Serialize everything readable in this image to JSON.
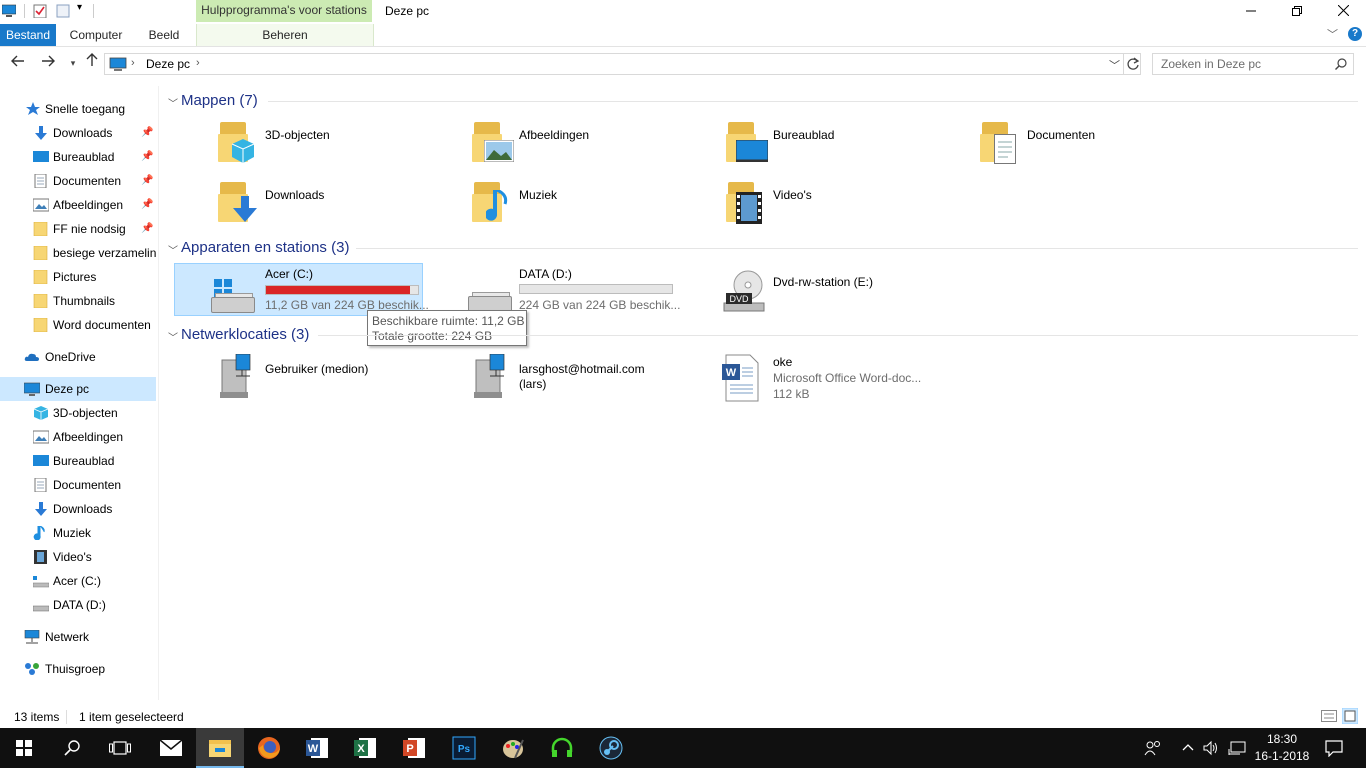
{
  "window": {
    "title": "Deze pc",
    "context_tab_header": "Hulpprogramma's voor stations",
    "controls": [
      "minimize",
      "maximize",
      "close"
    ]
  },
  "ribbon": {
    "tabs": [
      {
        "label": "Bestand",
        "active": true
      },
      {
        "label": "Computer"
      },
      {
        "label": "Beeld"
      },
      {
        "label": "Beheren"
      }
    ]
  },
  "address": {
    "breadcrumb": [
      "Deze pc"
    ],
    "search_placeholder": "Zoeken in Deze pc"
  },
  "nav_pane": {
    "quick_access": "Snelle toegang",
    "quick_items": [
      {
        "label": "Downloads",
        "icon": "download-arrow-icon",
        "pinned": true
      },
      {
        "label": "Bureaublad",
        "icon": "desktop-icon",
        "pinned": true
      },
      {
        "label": "Documenten",
        "icon": "document-icon",
        "pinned": true
      },
      {
        "label": "Afbeeldingen",
        "icon": "pictures-icon",
        "pinned": true
      },
      {
        "label": "FF nie nodsig",
        "icon": "folder-icon",
        "pinned": true
      },
      {
        "label": "besiege verzameling",
        "icon": "folder-icon"
      },
      {
        "label": "Pictures",
        "icon": "folder-icon"
      },
      {
        "label": "Thumbnails",
        "icon": "folder-icon"
      },
      {
        "label": "Word documenten",
        "icon": "folder-icon"
      }
    ],
    "onedrive": "OneDrive",
    "this_pc": "Deze pc",
    "this_pc_items": [
      {
        "label": "3D-objecten",
        "icon": "cube-icon"
      },
      {
        "label": "Afbeeldingen",
        "icon": "pictures-icon"
      },
      {
        "label": "Bureaublad",
        "icon": "desktop-icon"
      },
      {
        "label": "Documenten",
        "icon": "document-icon"
      },
      {
        "label": "Downloads",
        "icon": "download-arrow-icon"
      },
      {
        "label": "Muziek",
        "icon": "music-note-icon"
      },
      {
        "label": "Video's",
        "icon": "film-icon"
      },
      {
        "label": "Acer (C:)",
        "icon": "drive-icon"
      },
      {
        "label": "DATA (D:)",
        "icon": "drive-icon"
      }
    ],
    "network": "Netwerk",
    "homegroup": "Thuisgroep"
  },
  "content": {
    "folders_header": "Mappen (7)",
    "folders": [
      {
        "label": "3D-objecten",
        "overlay": "cube"
      },
      {
        "label": "Afbeeldingen",
        "overlay": "picture"
      },
      {
        "label": "Bureaublad",
        "overlay": "desktop"
      },
      {
        "label": "Documenten",
        "overlay": "document"
      },
      {
        "label": "Downloads",
        "overlay": "download"
      },
      {
        "label": "Muziek",
        "overlay": "music"
      },
      {
        "label": "Video's",
        "overlay": "film"
      }
    ],
    "devices_header": "Apparaten en stations (3)",
    "drives": [
      {
        "label": "Acer (C:)",
        "space": "11,2 GB van 224 GB beschik...",
        "used_fraction": 0.95,
        "bar_color": "#da2626",
        "selected": true
      },
      {
        "label": "DATA (D:)",
        "space": "224 GB van 224 GB beschik...",
        "used_fraction": 0.0,
        "bar_color": "#26a0da"
      },
      {
        "label": "Dvd-rw-station (E:)",
        "badge": "DVD"
      }
    ],
    "network_header": "Netwerklocaties (3)",
    "network_items": [
      {
        "label": "Gebruiker (medion)",
        "sub": ""
      },
      {
        "label": "larsghost@hotmail.com",
        "sub": "(lars)"
      },
      {
        "label": "oke",
        "sub": "Microsoft Office Word-doc...",
        "sub2": "112 kB"
      }
    ],
    "tooltip": {
      "line1": "Beschikbare ruimte: 11,2 GB",
      "line2": "Totale grootte: 224 GB"
    }
  },
  "status": {
    "count": "13 items",
    "selection": "1 item geselecteerd"
  },
  "taskbar": {
    "clock_time": "18:30",
    "clock_date": "16-1-2018",
    "apps": [
      "start",
      "search",
      "task-view",
      "mail",
      "file-explorer",
      "firefox",
      "word",
      "excel",
      "powerpoint",
      "photoshop",
      "paint",
      "razer",
      "steam"
    ]
  },
  "colors": {
    "accent": "#1979ca",
    "header_blue": "#1e3287",
    "selection": "#cce8ff",
    "context_tab": "#ccebb3"
  }
}
